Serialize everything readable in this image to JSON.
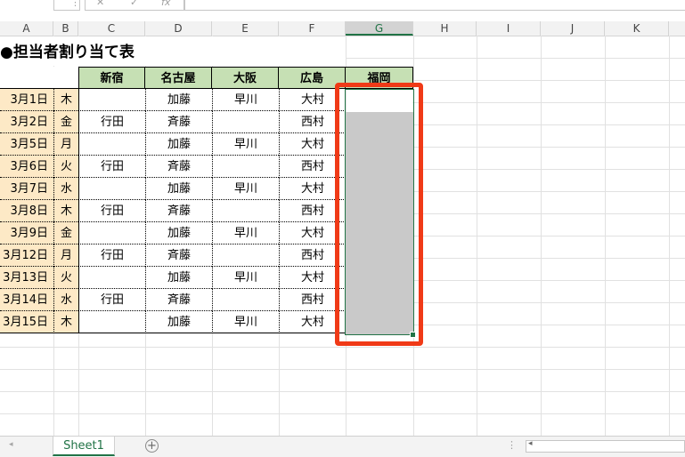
{
  "columns": [
    "A",
    "B",
    "C",
    "D",
    "E",
    "F",
    "G",
    "H",
    "I",
    "J",
    "K"
  ],
  "title": "●担当者割り当て表",
  "headers": [
    "新宿",
    "名古屋",
    "大阪",
    "広島",
    "福岡"
  ],
  "rows": [
    {
      "date": "3月1日",
      "day": "木",
      "shinjuku": "",
      "nagoya": "加藤",
      "osaka": "早川",
      "hiroshima": "大村"
    },
    {
      "date": "3月2日",
      "day": "金",
      "shinjuku": "行田",
      "nagoya": "斉藤",
      "osaka": "",
      "hiroshima": "西村"
    },
    {
      "date": "3月5日",
      "day": "月",
      "shinjuku": "",
      "nagoya": "加藤",
      "osaka": "早川",
      "hiroshima": "大村"
    },
    {
      "date": "3月6日",
      "day": "火",
      "shinjuku": "行田",
      "nagoya": "斉藤",
      "osaka": "",
      "hiroshima": "西村"
    },
    {
      "date": "3月7日",
      "day": "水",
      "shinjuku": "",
      "nagoya": "加藤",
      "osaka": "早川",
      "hiroshima": "大村"
    },
    {
      "date": "3月8日",
      "day": "木",
      "shinjuku": "行田",
      "nagoya": "斉藤",
      "osaka": "",
      "hiroshima": "西村"
    },
    {
      "date": "3月9日",
      "day": "金",
      "shinjuku": "",
      "nagoya": "加藤",
      "osaka": "早川",
      "hiroshima": "大村"
    },
    {
      "date": "3月12日",
      "day": "月",
      "shinjuku": "行田",
      "nagoya": "斉藤",
      "osaka": "",
      "hiroshima": "西村"
    },
    {
      "date": "3月13日",
      "day": "火",
      "shinjuku": "",
      "nagoya": "加藤",
      "osaka": "早川",
      "hiroshima": "大村"
    },
    {
      "date": "3月14日",
      "day": "水",
      "shinjuku": "行田",
      "nagoya": "斉藤",
      "osaka": "",
      "hiroshima": "西村"
    },
    {
      "date": "3月15日",
      "day": "木",
      "shinjuku": "",
      "nagoya": "加藤",
      "osaka": "早川",
      "hiroshima": "大村"
    }
  ],
  "sheet_tab": "Sheet1",
  "add_sheet_glyph": "+",
  "colors": {
    "header_fill": "#c6e0b4",
    "date_fill": "#fde9c6",
    "selection": "#217346",
    "highlight": "#f03a17",
    "selected_fill": "#c9c9c9"
  },
  "icons": [
    "cancel-icon",
    "confirm-icon",
    "function-icon",
    "add-sheet-icon",
    "scroll-left-icon"
  ]
}
